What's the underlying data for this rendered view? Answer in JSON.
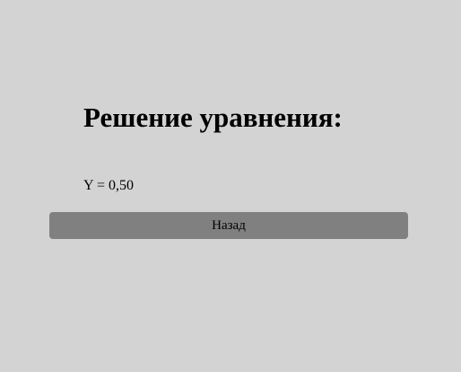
{
  "page": {
    "heading": "Решение уравнения:",
    "result_text": "Y = 0,50",
    "back_button_label": "Назад"
  },
  "colors": {
    "background": "#d3d3d3",
    "button": "#808080",
    "text": "#000000"
  }
}
